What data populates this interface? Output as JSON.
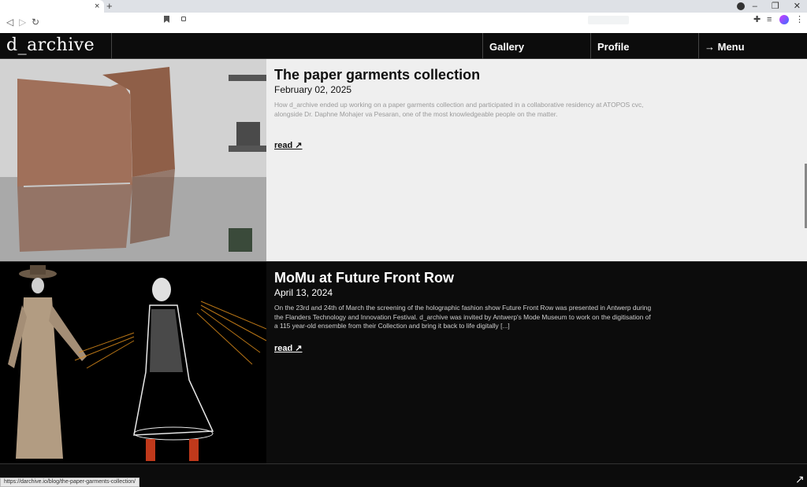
{
  "browser": {
    "tab_close": "×",
    "new_tab": "+",
    "nav": {
      "back": "◁",
      "forward": "▷",
      "reload": "↻"
    },
    "window": {
      "minimize": "–",
      "restore": "❐",
      "close": "✕"
    },
    "ext": {
      "puzzle": "✚",
      "queue": "≡",
      "menu": "⋮"
    },
    "status_url": "https://darchive.io/blog/the-paper-garments-collection/"
  },
  "site": {
    "logo": "d_archive",
    "nav": {
      "gallery": "Gallery",
      "profile": "Profile",
      "menu": "Menu",
      "menu_arrow": "→"
    }
  },
  "posts": [
    {
      "title": "The paper garments collection",
      "date": "February 02, 2025",
      "description": "How d_archive ended up working on a paper garments collection and participated in a collaborative residency at ATOPOS cvc, alongside Dr. Daphne Mohajer va Pesaran, one of the most knowledgeable people on the matter.",
      "read": "read ↗"
    },
    {
      "title": "MoMu at Future Front Row",
      "date": "April 13, 2024",
      "description": "On the 23rd and 24th of March the screening of the holographic fashion show Future Front Row was presented in Antwerp during the Flanders Technology and Innovation Festival.  d_archive was invited by Antwerp's Mode Museum to work on the digitisation of a 115 year-old ensemble from their Collection and bring it back to life digitally [...]",
      "read": "read ↗"
    }
  ],
  "corner_arrow": "↗",
  "colors": {
    "accent_dark": "#0c0c0c",
    "light_panel": "#efefef"
  }
}
